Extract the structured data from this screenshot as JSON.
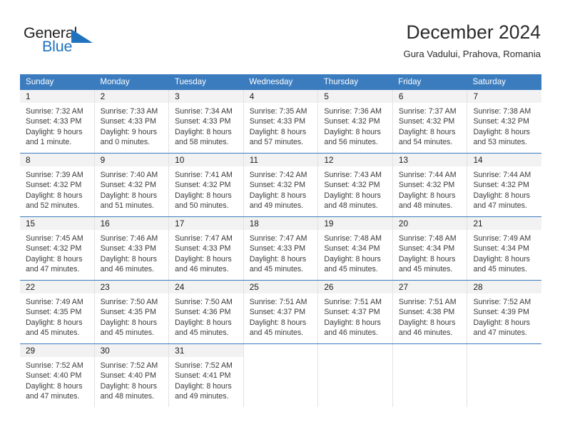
{
  "brand": {
    "name_part1": "General",
    "name_part2": "Blue",
    "accent_color": "#1f72bd"
  },
  "header": {
    "title": "December 2024",
    "subtitle": "Gura Vadului, Prahova, Romania"
  },
  "theme": {
    "header_bg": "#3b7cbf",
    "date_strip_bg": "#f2f2f2",
    "header_text": "#ffffff"
  },
  "weekdays": [
    "Sunday",
    "Monday",
    "Tuesday",
    "Wednesday",
    "Thursday",
    "Friday",
    "Saturday"
  ],
  "weeks": [
    [
      {
        "day": "1",
        "sunrise": "Sunrise: 7:32 AM",
        "sunset": "Sunset: 4:33 PM",
        "daylight1": "Daylight: 9 hours",
        "daylight2": "and 1 minute."
      },
      {
        "day": "2",
        "sunrise": "Sunrise: 7:33 AM",
        "sunset": "Sunset: 4:33 PM",
        "daylight1": "Daylight: 9 hours",
        "daylight2": "and 0 minutes."
      },
      {
        "day": "3",
        "sunrise": "Sunrise: 7:34 AM",
        "sunset": "Sunset: 4:33 PM",
        "daylight1": "Daylight: 8 hours",
        "daylight2": "and 58 minutes."
      },
      {
        "day": "4",
        "sunrise": "Sunrise: 7:35 AM",
        "sunset": "Sunset: 4:33 PM",
        "daylight1": "Daylight: 8 hours",
        "daylight2": "and 57 minutes."
      },
      {
        "day": "5",
        "sunrise": "Sunrise: 7:36 AM",
        "sunset": "Sunset: 4:32 PM",
        "daylight1": "Daylight: 8 hours",
        "daylight2": "and 56 minutes."
      },
      {
        "day": "6",
        "sunrise": "Sunrise: 7:37 AM",
        "sunset": "Sunset: 4:32 PM",
        "daylight1": "Daylight: 8 hours",
        "daylight2": "and 54 minutes."
      },
      {
        "day": "7",
        "sunrise": "Sunrise: 7:38 AM",
        "sunset": "Sunset: 4:32 PM",
        "daylight1": "Daylight: 8 hours",
        "daylight2": "and 53 minutes."
      }
    ],
    [
      {
        "day": "8",
        "sunrise": "Sunrise: 7:39 AM",
        "sunset": "Sunset: 4:32 PM",
        "daylight1": "Daylight: 8 hours",
        "daylight2": "and 52 minutes."
      },
      {
        "day": "9",
        "sunrise": "Sunrise: 7:40 AM",
        "sunset": "Sunset: 4:32 PM",
        "daylight1": "Daylight: 8 hours",
        "daylight2": "and 51 minutes."
      },
      {
        "day": "10",
        "sunrise": "Sunrise: 7:41 AM",
        "sunset": "Sunset: 4:32 PM",
        "daylight1": "Daylight: 8 hours",
        "daylight2": "and 50 minutes."
      },
      {
        "day": "11",
        "sunrise": "Sunrise: 7:42 AM",
        "sunset": "Sunset: 4:32 PM",
        "daylight1": "Daylight: 8 hours",
        "daylight2": "and 49 minutes."
      },
      {
        "day": "12",
        "sunrise": "Sunrise: 7:43 AM",
        "sunset": "Sunset: 4:32 PM",
        "daylight1": "Daylight: 8 hours",
        "daylight2": "and 48 minutes."
      },
      {
        "day": "13",
        "sunrise": "Sunrise: 7:44 AM",
        "sunset": "Sunset: 4:32 PM",
        "daylight1": "Daylight: 8 hours",
        "daylight2": "and 48 minutes."
      },
      {
        "day": "14",
        "sunrise": "Sunrise: 7:44 AM",
        "sunset": "Sunset: 4:32 PM",
        "daylight1": "Daylight: 8 hours",
        "daylight2": "and 47 minutes."
      }
    ],
    [
      {
        "day": "15",
        "sunrise": "Sunrise: 7:45 AM",
        "sunset": "Sunset: 4:32 PM",
        "daylight1": "Daylight: 8 hours",
        "daylight2": "and 47 minutes."
      },
      {
        "day": "16",
        "sunrise": "Sunrise: 7:46 AM",
        "sunset": "Sunset: 4:33 PM",
        "daylight1": "Daylight: 8 hours",
        "daylight2": "and 46 minutes."
      },
      {
        "day": "17",
        "sunrise": "Sunrise: 7:47 AM",
        "sunset": "Sunset: 4:33 PM",
        "daylight1": "Daylight: 8 hours",
        "daylight2": "and 46 minutes."
      },
      {
        "day": "18",
        "sunrise": "Sunrise: 7:47 AM",
        "sunset": "Sunset: 4:33 PM",
        "daylight1": "Daylight: 8 hours",
        "daylight2": "and 45 minutes."
      },
      {
        "day": "19",
        "sunrise": "Sunrise: 7:48 AM",
        "sunset": "Sunset: 4:34 PM",
        "daylight1": "Daylight: 8 hours",
        "daylight2": "and 45 minutes."
      },
      {
        "day": "20",
        "sunrise": "Sunrise: 7:48 AM",
        "sunset": "Sunset: 4:34 PM",
        "daylight1": "Daylight: 8 hours",
        "daylight2": "and 45 minutes."
      },
      {
        "day": "21",
        "sunrise": "Sunrise: 7:49 AM",
        "sunset": "Sunset: 4:34 PM",
        "daylight1": "Daylight: 8 hours",
        "daylight2": "and 45 minutes."
      }
    ],
    [
      {
        "day": "22",
        "sunrise": "Sunrise: 7:49 AM",
        "sunset": "Sunset: 4:35 PM",
        "daylight1": "Daylight: 8 hours",
        "daylight2": "and 45 minutes."
      },
      {
        "day": "23",
        "sunrise": "Sunrise: 7:50 AM",
        "sunset": "Sunset: 4:35 PM",
        "daylight1": "Daylight: 8 hours",
        "daylight2": "and 45 minutes."
      },
      {
        "day": "24",
        "sunrise": "Sunrise: 7:50 AM",
        "sunset": "Sunset: 4:36 PM",
        "daylight1": "Daylight: 8 hours",
        "daylight2": "and 45 minutes."
      },
      {
        "day": "25",
        "sunrise": "Sunrise: 7:51 AM",
        "sunset": "Sunset: 4:37 PM",
        "daylight1": "Daylight: 8 hours",
        "daylight2": "and 45 minutes."
      },
      {
        "day": "26",
        "sunrise": "Sunrise: 7:51 AM",
        "sunset": "Sunset: 4:37 PM",
        "daylight1": "Daylight: 8 hours",
        "daylight2": "and 46 minutes."
      },
      {
        "day": "27",
        "sunrise": "Sunrise: 7:51 AM",
        "sunset": "Sunset: 4:38 PM",
        "daylight1": "Daylight: 8 hours",
        "daylight2": "and 46 minutes."
      },
      {
        "day": "28",
        "sunrise": "Sunrise: 7:52 AM",
        "sunset": "Sunset: 4:39 PM",
        "daylight1": "Daylight: 8 hours",
        "daylight2": "and 47 minutes."
      }
    ],
    [
      {
        "day": "29",
        "sunrise": "Sunrise: 7:52 AM",
        "sunset": "Sunset: 4:40 PM",
        "daylight1": "Daylight: 8 hours",
        "daylight2": "and 47 minutes."
      },
      {
        "day": "30",
        "sunrise": "Sunrise: 7:52 AM",
        "sunset": "Sunset: 4:40 PM",
        "daylight1": "Daylight: 8 hours",
        "daylight2": "and 48 minutes."
      },
      {
        "day": "31",
        "sunrise": "Sunrise: 7:52 AM",
        "sunset": "Sunset: 4:41 PM",
        "daylight1": "Daylight: 8 hours",
        "daylight2": "and 49 minutes."
      },
      {
        "day": "",
        "sunrise": "",
        "sunset": "",
        "daylight1": "",
        "daylight2": ""
      },
      {
        "day": "",
        "sunrise": "",
        "sunset": "",
        "daylight1": "",
        "daylight2": ""
      },
      {
        "day": "",
        "sunrise": "",
        "sunset": "",
        "daylight1": "",
        "daylight2": ""
      },
      {
        "day": "",
        "sunrise": "",
        "sunset": "",
        "daylight1": "",
        "daylight2": ""
      }
    ]
  ]
}
